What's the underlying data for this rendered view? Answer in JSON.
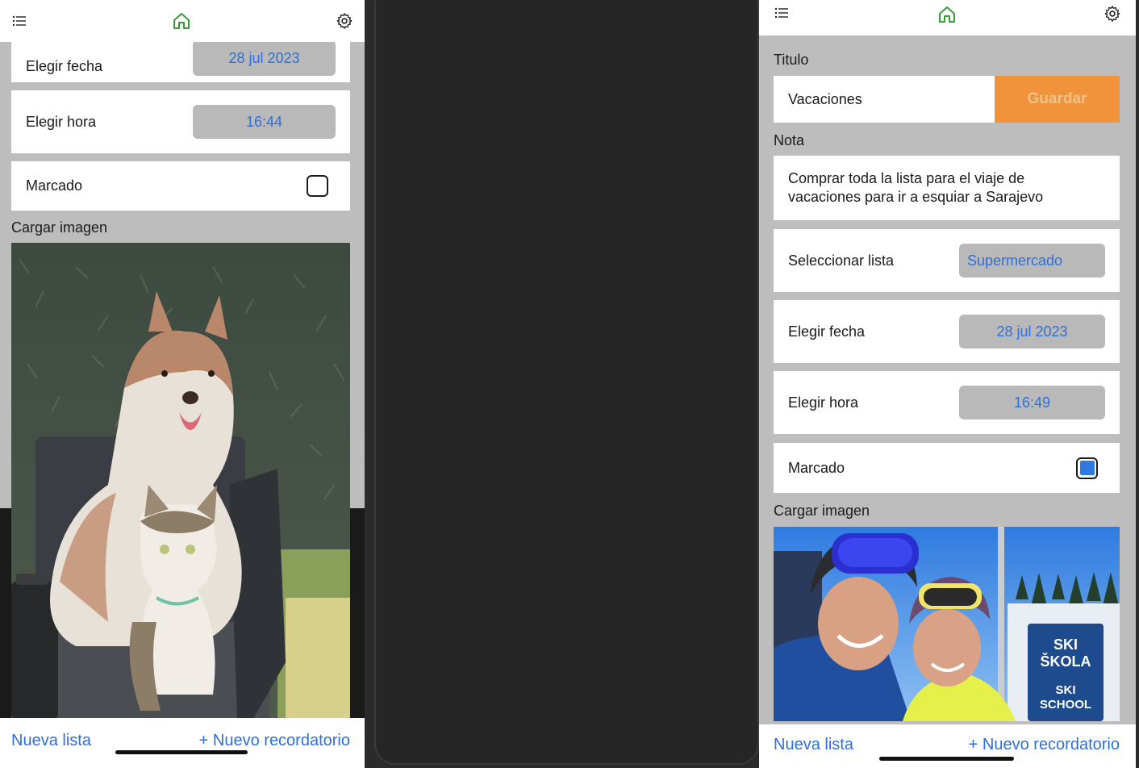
{
  "left": {
    "topbar": {
      "menu_icon": "list-icon",
      "home_icon": "home-icon",
      "settings_icon": "gear-icon"
    },
    "fecha": {
      "label": "Elegir fecha",
      "value": "28 jul 2023"
    },
    "hora": {
      "label": "Elegir hora",
      "value": "16:44"
    },
    "marcado": {
      "label": "Marcado",
      "checked": false
    },
    "imagen": {
      "label": "Cargar imagen"
    },
    "bottom": {
      "nueva_lista": "Nueva lista",
      "nuevo_recordatorio": "+ Nuevo recordatorio"
    }
  },
  "right": {
    "topbar": {
      "menu_icon": "list-icon",
      "home_icon": "home-icon",
      "settings_icon": "gear-icon"
    },
    "titulo": {
      "label": "Titulo",
      "value": "Vacaciones",
      "save": "Guardar"
    },
    "nota": {
      "label": "Nota",
      "value": "Comprar toda la lista para el viaje de vacaciones para ir a esquiar a Sarajevo"
    },
    "lista": {
      "label": "Seleccionar lista",
      "value": "Supermercado"
    },
    "fecha": {
      "label": "Elegir fecha",
      "value": "28 jul 2023"
    },
    "hora": {
      "label": "Elegir hora",
      "value": "16:49"
    },
    "marcado": {
      "label": "Marcado",
      "checked": true
    },
    "imagen": {
      "label": "Cargar imagen",
      "sign_lines": [
        "SKI",
        "ŠKOLA",
        "SKI",
        "SCHOOL"
      ]
    },
    "bottom": {
      "nueva_lista": "Nueva lista",
      "nuevo_recordatorio": "+ Nuevo recordatorio"
    }
  },
  "colors": {
    "accent": "#2f6fdb",
    "home_green": "#3a9a3a",
    "save_orange": "#f0933a",
    "checkbox_blue": "#2e7ae0"
  }
}
